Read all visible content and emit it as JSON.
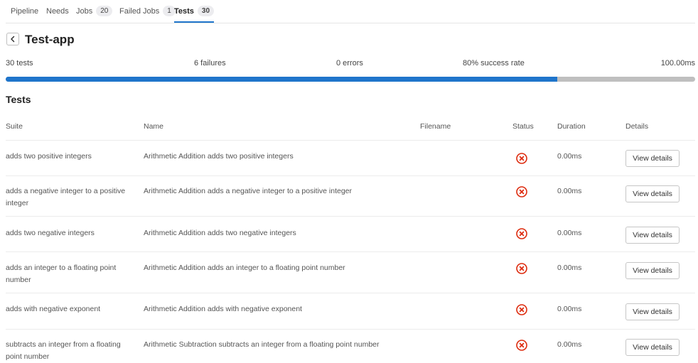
{
  "tabs": [
    {
      "label": "Pipeline",
      "count": null
    },
    {
      "label": "Needs",
      "count": null
    },
    {
      "label": "Jobs",
      "count": "20"
    },
    {
      "label": "Failed Jobs",
      "count": "1"
    },
    {
      "label": "Tests",
      "count": "30"
    }
  ],
  "suite": {
    "title": "Test-app"
  },
  "summary": {
    "tests": "30 tests",
    "failures": "6 failures",
    "errors": "0 errors",
    "success_rate": "80% success rate",
    "duration": "100.00ms",
    "success_fraction": 0.8
  },
  "section_title": "Tests",
  "table": {
    "headers": {
      "suite": "Suite",
      "name": "Name",
      "filename": "Filename",
      "status": "Status",
      "duration": "Duration",
      "details": "Details"
    },
    "rows": [
      {
        "suite": "adds two positive integers",
        "name": "Arithmetic Addition adds two positive integers",
        "filename": "",
        "status": "failed",
        "duration": "0.00ms",
        "action": "View details"
      },
      {
        "suite": "adds a negative integer to a positive integer",
        "name": "Arithmetic Addition adds a negative integer to a positive integer",
        "filename": "",
        "status": "failed",
        "duration": "0.00ms",
        "action": "View details"
      },
      {
        "suite": "adds two negative integers",
        "name": "Arithmetic Addition adds two negative integers",
        "filename": "",
        "status": "failed",
        "duration": "0.00ms",
        "action": "View details"
      },
      {
        "suite": "adds an integer to a floating point number",
        "name": "Arithmetic Addition adds an integer to a floating point number",
        "filename": "",
        "status": "failed",
        "duration": "0.00ms",
        "action": "View details"
      },
      {
        "suite": "adds with negative exponent",
        "name": "Arithmetic Addition adds with negative exponent",
        "filename": "",
        "status": "failed",
        "duration": "0.00ms",
        "action": "View details"
      },
      {
        "suite": "subtracts an integer from a floating point number",
        "name": "Arithmetic Subtraction subtracts an integer from a floating point number",
        "filename": "",
        "status": "failed",
        "duration": "0.00ms",
        "action": "View details"
      }
    ]
  },
  "colors": {
    "accent": "#1f75cb",
    "failed": "#dd2b0e",
    "progress_track": "#bfbfbf"
  }
}
